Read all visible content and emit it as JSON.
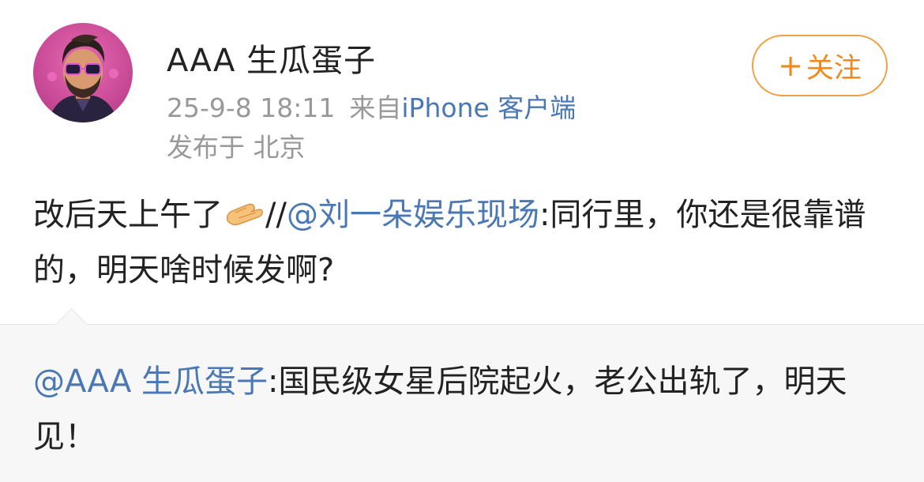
{
  "post": {
    "username": "AAA 生瓜蛋子",
    "timestamp": "25-9-8 18:11",
    "source_prefix": "来自",
    "source_client": "iPhone 客户端",
    "location": "发布于 北京",
    "follow_button": {
      "icon": "plus-icon",
      "label": "关注",
      "symbol": "+"
    },
    "body": {
      "text_before": "改后天上午了",
      "emoji": "pinching-hand-emoji",
      "separator": "//",
      "mention": "@刘一朵娱乐现场",
      "text_after": ":同行里，你还是很靠谱的，明天啥时候发啊?"
    }
  },
  "retweet": {
    "mention": "@AAA 生瓜蛋子",
    "text": ":国民级女星后院起火，老公出轨了，明天见！"
  },
  "colors": {
    "link": "#4a78b4",
    "follow_accent": "#f08a1e",
    "meta_gray": "#999999",
    "retweet_bg": "#f7f7f7"
  }
}
